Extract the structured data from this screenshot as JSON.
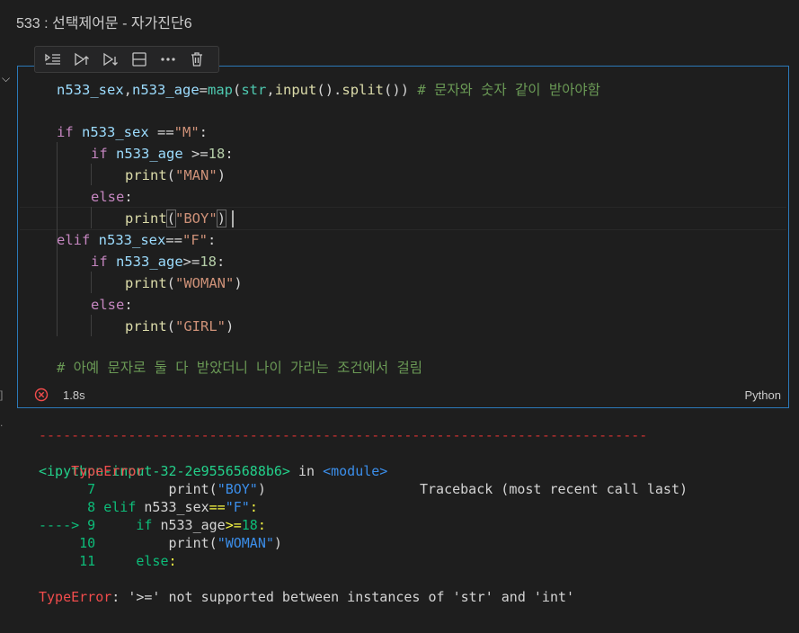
{
  "title": "533 : 선택제어문 - 자가진단6",
  "toolbar": {
    "icons": [
      "run-by-line-icon",
      "execute-above-icon",
      "execute-below-icon",
      "split-cell-icon",
      "more-icon",
      "delete-icon"
    ]
  },
  "code": {
    "l1": {
      "a": "n533_sex",
      "b": ",",
      "c": "n533_age",
      "d": "=",
      "e": "map",
      "f": "(",
      "g": "str",
      ",": ",",
      "h": "input",
      "i": "().",
      "j": "split",
      "k": "()) ",
      "cmt": "# 문자와 숫자 같이 받아야함"
    },
    "l3": {
      "kw": "if ",
      "v": "n533_sex ",
      "op": "==",
      "s": "\"M\"",
      "c": ":"
    },
    "l4": {
      "kw": "if ",
      "v": "n533_age ",
      "op": ">=",
      "n": "18",
      "c": ":"
    },
    "l5": {
      "fn": "print",
      "p1": "(",
      "s": "\"MAN\"",
      "p2": ")"
    },
    "l6": {
      "kw": "else",
      ":": ":"
    },
    "l7": {
      "fn": "print",
      "p1": "(",
      "s": "\"BOY\"",
      "p2": ")"
    },
    "l8": {
      "kw": "elif ",
      "v": "n533_sex",
      "op": "==",
      "s": "\"F\"",
      "c": ":"
    },
    "l9": {
      "kw": "if ",
      "v": "n533_age",
      "op": ">=",
      "n": "18",
      "c": ":"
    },
    "l10": {
      "fn": "print",
      "p1": "(",
      "s": "\"WOMAN\"",
      "p2": ")"
    },
    "l11": {
      "kw": "else",
      ":": ":"
    },
    "l12": {
      "fn": "print",
      "p1": "(",
      "s": "\"GIRL\"",
      "p2": ")"
    },
    "l14": {
      "cmt": "# 아예 문자로 둘 다 받았더니 나이 가리는 조건에서 걸림"
    }
  },
  "status": {
    "time": "1.8s",
    "language": "Python"
  },
  "gutter": {
    "bracket": "]",
    "dot": "."
  },
  "output": {
    "dashes": "---------------------------------------------------------------------------",
    "err_name": "TypeError",
    "traceback": "Traceback (most recent call last)",
    "input_ref": "<ipython-input-32-2e95565688b6>",
    "in_word": " in ",
    "module": "<module>",
    "t7_num": "      7",
    "t7_code": "         print",
    "t7_p1": "(",
    "t7_s": "\"BOY\"",
    "t7_p2": ")",
    "t8_num": "      8",
    "t8_kw": " elif",
    "t8_code": " n533_sex",
    "t8_op": "==",
    "t8_s": "\"F\"",
    "t8_c": ":",
    "arrow": "----> 9",
    "t9_kw": "     if",
    "t9_code": " n533_age",
    "t9_op": ">=",
    "t9_n": "18",
    "t9_c": ":",
    "t10_num": "     10",
    "t10_code": "         print",
    "t10_p1": "(",
    "t10_s": "\"WOMAN\"",
    "t10_p2": ")",
    "t11_num": "     11",
    "t11_kw": "     else",
    "t11_c": ":",
    "final_name": "TypeError",
    "final_msg": ": '>=' not supported between instances of 'str' and 'int'"
  }
}
